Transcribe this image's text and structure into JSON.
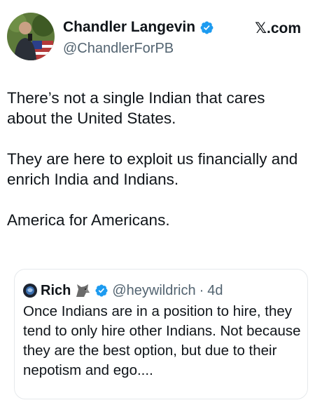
{
  "site": {
    "label": "𝕏.com"
  },
  "author": {
    "display_name": "Chandler Langevin",
    "handle": "@ChandlerForPB",
    "verified_icon": "verified-badge-icon"
  },
  "tweet": {
    "paragraphs": [
      "There’s not a single Indian that cares about the United States.",
      "They are here to exploit us financially and enrich India and Indians.",
      "America for Americans."
    ]
  },
  "quoted_tweet": {
    "display_name": "Rich",
    "name_emoji_icon": "wolf-icon",
    "verified_icon": "verified-badge-icon",
    "handle": "@heywildrich",
    "separator": "·",
    "time": "4d",
    "text": "Once Indians are in a position to hire, they tend to only hire other Indians. Not because they are the best option, but due to their nepotism and ego...."
  },
  "colors": {
    "text_primary": "#0f1419",
    "text_secondary": "#536471",
    "verified_blue": "#1d9bf0",
    "border": "#e6e9ec"
  }
}
